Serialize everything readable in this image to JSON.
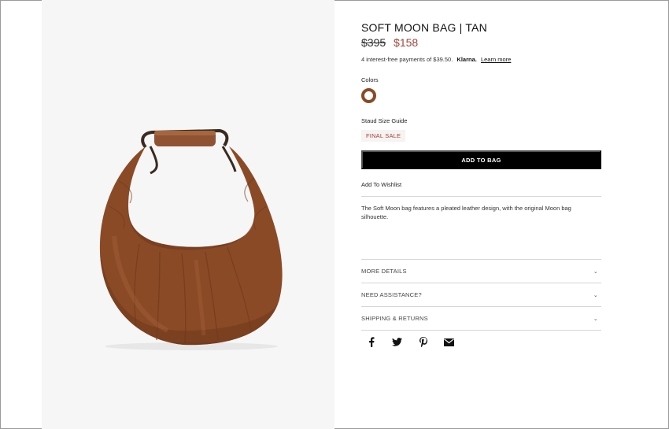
{
  "product": {
    "title": "SOFT MOON BAG | TAN",
    "old_price": "$395",
    "sale_price": "$158",
    "klarna": {
      "text": "4 interest-free payments of $39.50.",
      "brand": "Klarna.",
      "link": "Learn more"
    },
    "colors_label": "Colors",
    "selected_color": "#8b4a26",
    "size_guide": "Staud Size Guide",
    "badge": "FINAL SALE",
    "add_to_bag": "ADD TO BAG",
    "wishlist": "Add To Wishlist",
    "description": "The Soft Moon bag features a pleated leather design, with the original Moon bag silhouette."
  },
  "accordion": [
    {
      "label": "MORE DETAILS"
    },
    {
      "label": "NEED ASSISTANCE?"
    },
    {
      "label": "SHIPPING & RETURNS"
    }
  ],
  "social": [
    "facebook-icon",
    "twitter-icon",
    "pinterest-icon",
    "email-icon"
  ],
  "colors": {
    "sale": "#a0443a",
    "bag": "#8b4a26",
    "button": "#000000"
  }
}
